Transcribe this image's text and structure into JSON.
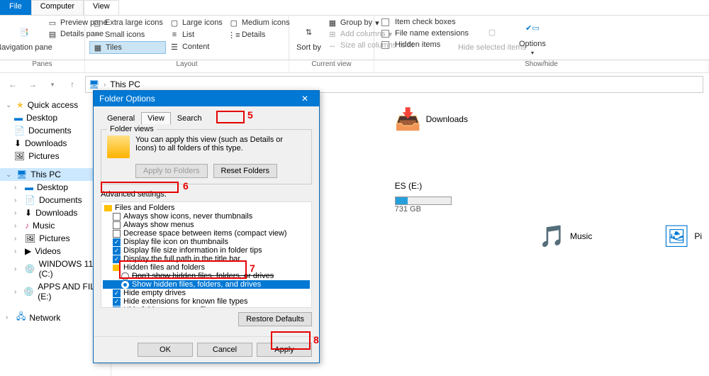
{
  "tabs": {
    "file": "File",
    "computer": "Computer",
    "view": "View"
  },
  "ribbon": {
    "panes": {
      "nav": "Navigation pane",
      "preview": "Preview pane",
      "details": "Details pane",
      "title": "Panes"
    },
    "layout": {
      "xl": "Extra large icons",
      "lg": "Large icons",
      "md": "Medium icons",
      "sm": "Small icons",
      "list": "List",
      "det": "Details",
      "tiles": "Tiles",
      "content": "Content",
      "title": "Layout"
    },
    "cv": {
      "sort": "Sort by",
      "group": "Group by",
      "addcol": "Add columns",
      "sizecol": "Size all columns to fit",
      "title": "Current view"
    },
    "sh": {
      "itemchk": "Item check boxes",
      "ext": "File name extensions",
      "hidden": "Hidden items",
      "hidesel": "Hide selected items",
      "options": "Options",
      "title": "Show/hide"
    }
  },
  "address": "This PC",
  "sidebar": {
    "quick": "Quick access",
    "q": [
      "Desktop",
      "Documents",
      "Downloads",
      "Pictures"
    ],
    "thispc": "This PC",
    "pc": [
      "Desktop",
      "Documents",
      "Downloads",
      "Music",
      "Pictures",
      "Videos",
      "WINDOWS 11 (C:)",
      "APPS AND FILES (E:)"
    ],
    "network": "Network"
  },
  "folders": {
    "dl": "Downloads",
    "music": "Music",
    "pics": "Pi"
  },
  "drive": {
    "name": "ES (E:)",
    "free": "731 GB",
    "fill": 22
  },
  "dialog": {
    "title": "Folder Options",
    "tabs": {
      "general": "General",
      "view": "View",
      "search": "Search"
    },
    "fv": {
      "legend": "Folder views",
      "text": "You can apply this view (such as Details or Icons) to all folders of this type.",
      "apply": "Apply to Folders",
      "reset": "Reset Folders"
    },
    "as": "Advanced settings:",
    "tree": {
      "root": "Files and Folders",
      "items": [
        {
          "t": "chk",
          "on": false,
          "l": "Always show icons, never thumbnails"
        },
        {
          "t": "chk",
          "on": false,
          "l": "Always show menus"
        },
        {
          "t": "chk",
          "on": false,
          "l": "Decrease space between items (compact view)"
        },
        {
          "t": "chk",
          "on": true,
          "l": "Display file icon on thumbnails"
        },
        {
          "t": "chk",
          "on": true,
          "l": "Display file size information in folder tips"
        },
        {
          "t": "chk",
          "on": true,
          "l": "Display the full path in the title bar"
        },
        {
          "t": "fld",
          "l": "Hidden files and folders"
        },
        {
          "t": "rad",
          "on": false,
          "l2": true,
          "strike": true,
          "l": "Don't show hidden files, folders, or drives"
        },
        {
          "t": "rad",
          "on": true,
          "l2": true,
          "sel": true,
          "l": "Show hidden files, folders, and drives"
        },
        {
          "t": "chk",
          "on": true,
          "l": "Hide empty drives"
        },
        {
          "t": "chk",
          "on": true,
          "l": "Hide extensions for known file types"
        },
        {
          "t": "chk",
          "on": true,
          "l": "Hide folder merge conflicts"
        }
      ]
    },
    "restore": "Restore Defaults",
    "btn": {
      "ok": "OK",
      "cancel": "Cancel",
      "apply": "Apply"
    }
  },
  "ann": {
    "n5": "5",
    "n6": "6",
    "n7": "7",
    "n8": "8"
  }
}
